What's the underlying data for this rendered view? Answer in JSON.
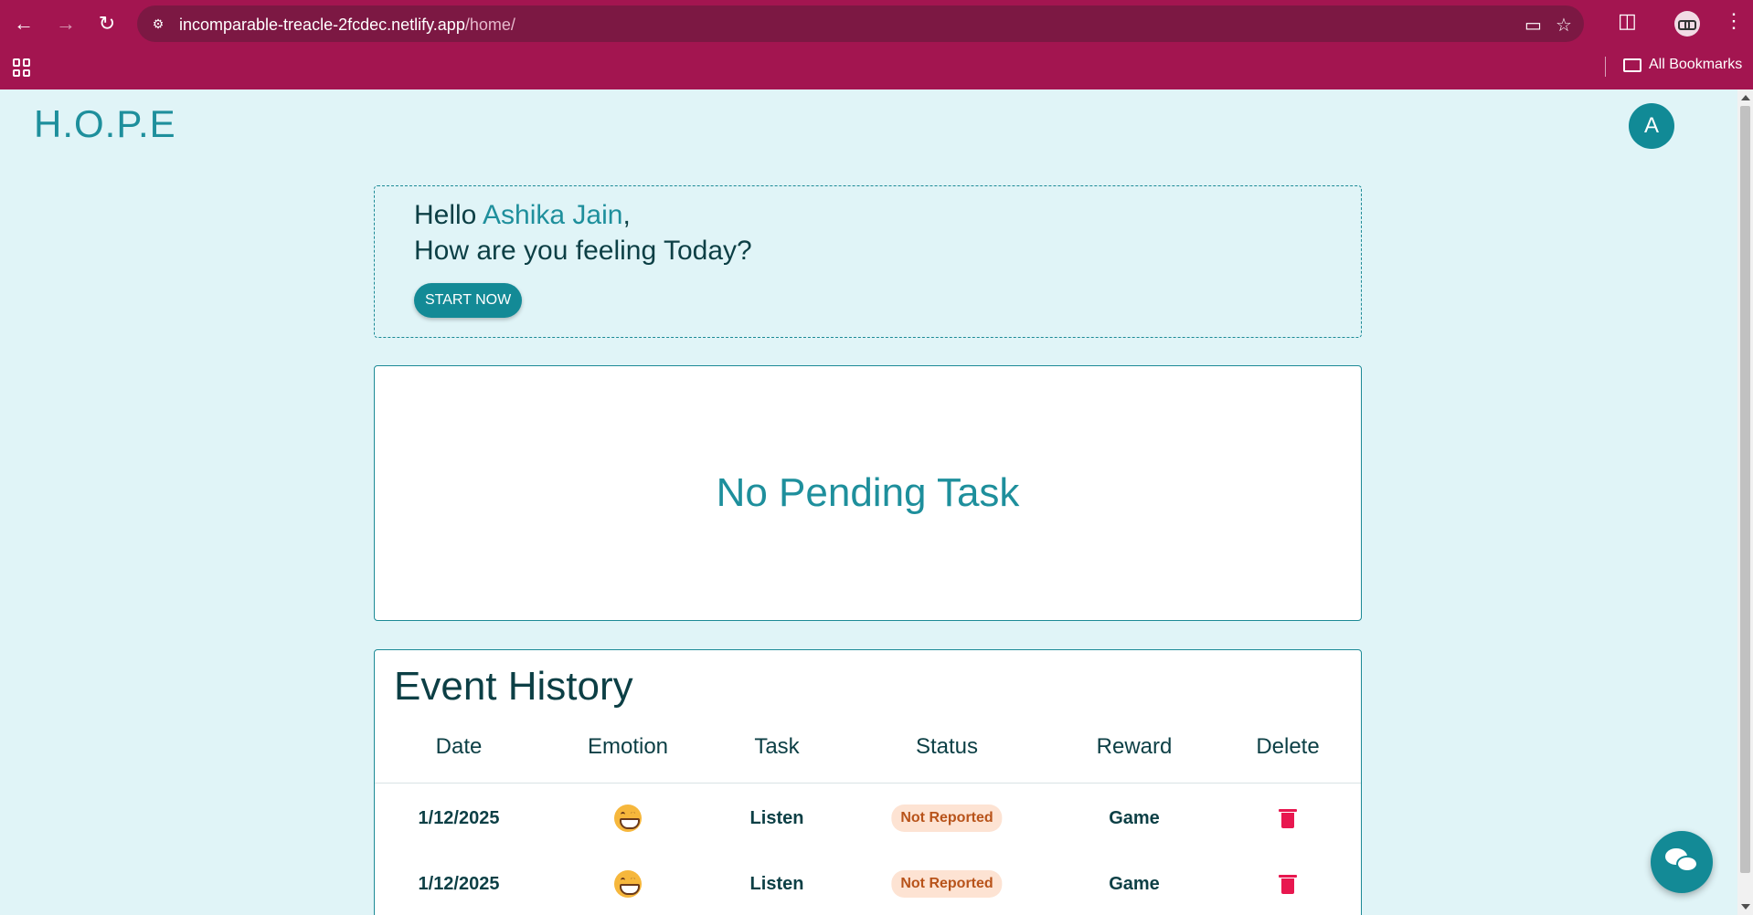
{
  "browser": {
    "url_host": "incomparable-treacle-2fcdec.netlify.app",
    "url_path": "/home/",
    "bookmarks_label": "All Bookmarks"
  },
  "app": {
    "logo": "H.O.P.E",
    "avatar_letter": "A"
  },
  "greeting": {
    "hello": "Hello ",
    "name": "Ashika Jain",
    "comma": ",",
    "question": "How are you feeling Today?",
    "start_label": "START NOW"
  },
  "pending": {
    "message": "No Pending Task"
  },
  "history": {
    "title": "Event History",
    "columns": [
      "Date",
      "Emotion",
      "Task",
      "Status",
      "Reward",
      "Delete"
    ],
    "rows": [
      {
        "date": "1/12/2025",
        "emotion": "grinning-face",
        "task": "Listen",
        "status": "Not Reported",
        "reward": "Game"
      },
      {
        "date": "1/12/2025",
        "emotion": "grinning-face",
        "task": "Listen",
        "status": "Not Reported",
        "reward": "Game"
      }
    ]
  },
  "colors": {
    "chrome": "#a31550",
    "accent": "#138a96",
    "page_bg": "#e0f4f7",
    "delete": "#e8174f"
  }
}
